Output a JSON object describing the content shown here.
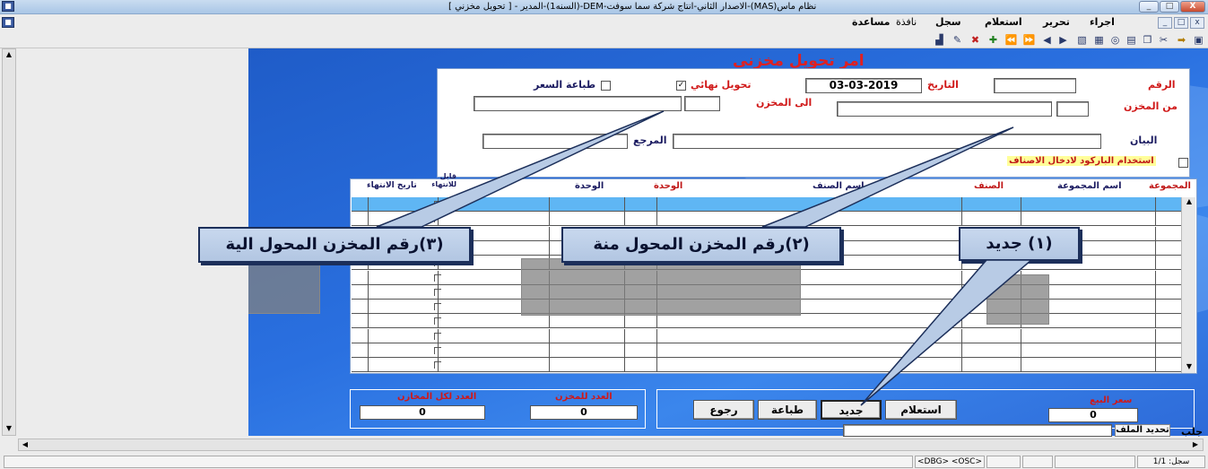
{
  "window": {
    "title": "نظام ماس(MAS)-الاصدار الثاني-انتاج شركة سما سوفت-DEM-(السنه1)-المدير - [ تحويل مخزني ]",
    "controls": [
      "_",
      "□",
      "X"
    ]
  },
  "menu": {
    "items": [
      "اجراء",
      "تحرير",
      "استعلام",
      "سجل",
      "نافذة",
      "مساعدة"
    ],
    "mdi_controls": [
      "x",
      "□",
      "_"
    ]
  },
  "toolbar": {
    "icons": [
      "save-icon",
      "insert-icon",
      "close-icon",
      "copy-icon",
      "paste-icon",
      "find-icon",
      "print-icon",
      "print-preview-icon",
      "prev-icon",
      "next-icon",
      "last-icon",
      "first-icon",
      "add-icon",
      "remove-icon",
      "tools-icon",
      "printer-icon"
    ]
  },
  "form": {
    "title": "امر تحويل مخزني",
    "number_label": "الرقم",
    "date_label": "التاريخ",
    "date_value": "03-03-2019",
    "final_transfer_label": "تحويل نهائي",
    "final_transfer_checked": true,
    "print_price_label": "طباعة السعر",
    "print_price_checked": false,
    "from_store_label": "من المخزن",
    "to_store_label": "الى المخزن",
    "statement_label": "البيان",
    "reference_label": "المرجع",
    "barcode_label": "استخدام الباركود لادخال الاصناف"
  },
  "grid": {
    "columns": [
      "المجموعة",
      "اسم المجموعة",
      "الصنف",
      "اسم الصنف",
      "الوحدة",
      "الوحدة",
      "قابل للانتهاء",
      "تاريخ الانتهاء"
    ],
    "row_count": 12
  },
  "buttons": {
    "query": "استعلام",
    "new": "جديد",
    "print": "طباعة",
    "back": "رجوع"
  },
  "totals": {
    "sale_price_label": "سعر البيع",
    "sale_price_value": "0",
    "count_store_label": "العدد للمخزن",
    "count_store_value": "0",
    "count_all_label": "العدد لكل المخازن",
    "count_all_value": "0"
  },
  "bottom": {
    "fetch_label": "جلب",
    "file_select_label": "تحديد الملف"
  },
  "status": {
    "record": "سجل: 1/1",
    "dbg": "<DBG> <OSC>"
  },
  "callouts": {
    "one": "(١) جديد",
    "two": "(٢)رقم المخزن المحول منة",
    "three": "(٣)رقم المخزن المحول الية"
  }
}
